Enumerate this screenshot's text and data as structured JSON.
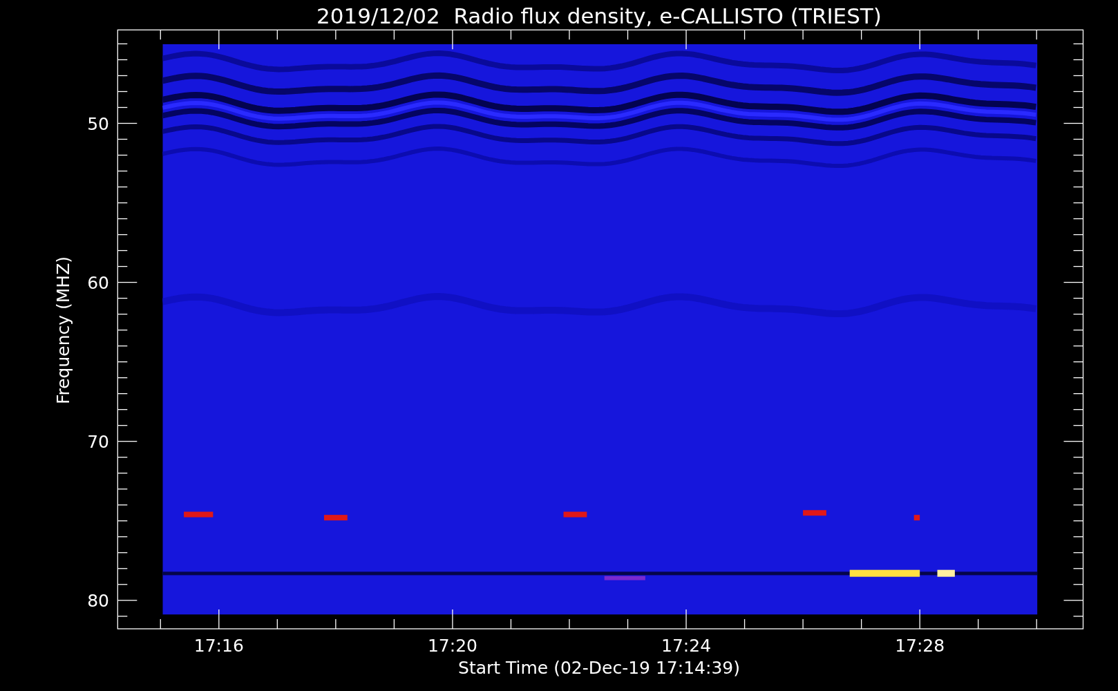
{
  "title": "2019/12/02  Radio flux density, e-CALLISTO (TRIEST)",
  "plot": {
    "ylabel": "Frequency (MHZ)",
    "xlabel": "Start Time (02-Dec-19 17:14:39)",
    "yticks": [
      {
        "label": "50"
      },
      {
        "label": "60"
      },
      {
        "label": "70"
      },
      {
        "label": "80"
      }
    ],
    "xticks": [
      {
        "label": "17:16"
      },
      {
        "label": "17:20"
      },
      {
        "label": "17:24"
      },
      {
        "label": "17:28"
      }
    ]
  }
}
